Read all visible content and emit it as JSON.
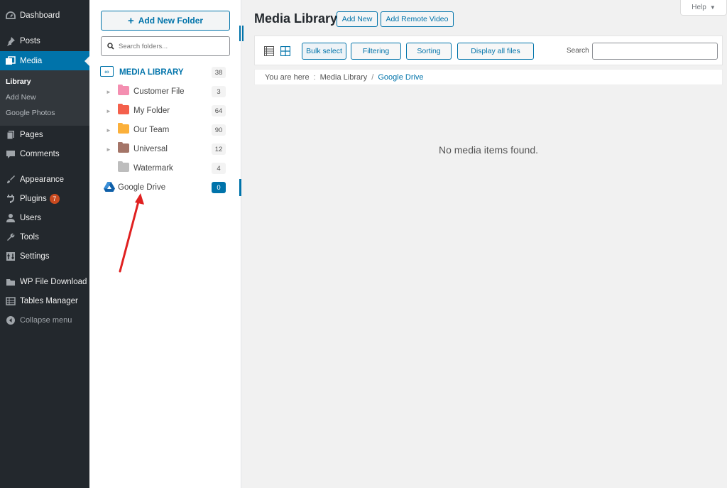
{
  "admin_menu": {
    "items": [
      {
        "label": "Dashboard",
        "icon": "dashboard-icon"
      },
      {
        "label": "Posts",
        "icon": "pushpin-icon"
      },
      {
        "label": "Media",
        "icon": "media-icon"
      },
      {
        "label": "Pages",
        "icon": "pages-icon"
      },
      {
        "label": "Comments",
        "icon": "comments-icon"
      },
      {
        "label": "Appearance",
        "icon": "paintbrush-icon"
      },
      {
        "label": "Plugins",
        "icon": "plugin-icon",
        "badge": "7"
      },
      {
        "label": "Users",
        "icon": "users-icon"
      },
      {
        "label": "Tools",
        "icon": "wrench-icon"
      },
      {
        "label": "Settings",
        "icon": "settings-icon"
      },
      {
        "label": "WP File Download",
        "icon": "folder-icon"
      },
      {
        "label": "Tables Manager",
        "icon": "table-icon"
      },
      {
        "label": "Collapse menu",
        "icon": "collapse-icon"
      }
    ],
    "submenu": [
      {
        "label": "Library"
      },
      {
        "label": "Add New"
      },
      {
        "label": "Google Photos"
      }
    ],
    "active_color": "#0073aa"
  },
  "folder_panel": {
    "add_folder_label": "Add New Folder",
    "search_placeholder": "Search folders...",
    "root": {
      "label": "MEDIA LIBRARY",
      "count": "38"
    },
    "folders": [
      {
        "label": "Customer File",
        "count": "3",
        "color": "#f48fb1"
      },
      {
        "label": "My Folder",
        "count": "64",
        "color": "#f4604c"
      },
      {
        "label": "Our Team",
        "count": "90",
        "color": "#fbb03b"
      },
      {
        "label": "Universal",
        "count": "12",
        "color": "#a47568"
      },
      {
        "label": "Watermark",
        "count": "4",
        "color": "#bdbdbd"
      }
    ],
    "cloud": {
      "label": "Google Drive",
      "count": "0"
    }
  },
  "main": {
    "title": "Media Library",
    "add_new_label": "Add New",
    "add_remote_video_label": "Add Remote Video",
    "help_label": "Help",
    "toolbar": {
      "bulk_select_label": "Bulk select",
      "filtering_label": "Filtering",
      "sorting_label": "Sorting",
      "display_all_label": "Display all files",
      "search_label": "Search",
      "search_value": ""
    },
    "breadcrumb": {
      "prefix": "You are here",
      "separator_colon": ":",
      "items": [
        "Media Library",
        "Google Drive"
      ],
      "separator": "/"
    },
    "empty_message": "No media items found."
  },
  "colors": {
    "accent": "#0073aa",
    "sidebar_bg": "#23282d",
    "annotation_arrow": "#e02020"
  }
}
